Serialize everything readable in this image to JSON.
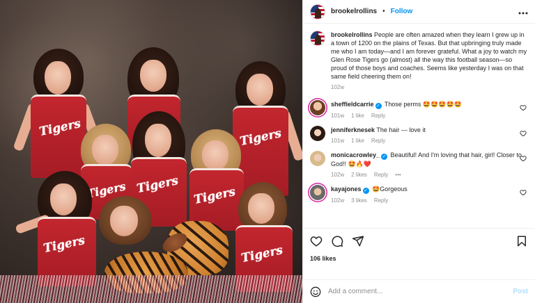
{
  "post": {
    "username": "brookelrollins",
    "separator": "•",
    "follow_label": "Follow",
    "more_label": "•••",
    "photo_team_text": "Tigers"
  },
  "caption": {
    "username": "brookelrollins",
    "text": "People are often amazed when they learn I grew up in a town of 1200 on the plains of Texas. But that upbringing truly made me who I am today—and I am forever grateful. What a joy to watch my Glen Rose Tigers go (almost) all the way this football season—so proud of those boys and coaches. Seems like yesterday I was on that same field cheering them on!",
    "time": "102w"
  },
  "comments": [
    {
      "username": "sheffieldcarrie",
      "verified": true,
      "text": "Those perms 🤩🤩🤩🤩🤩",
      "time": "101w",
      "likes": "1 like",
      "reply": "Reply",
      "more": ""
    },
    {
      "username": "jenniferknesek",
      "verified": false,
      "text": "The hair — love it",
      "time": "101w",
      "likes": "1 like",
      "reply": "Reply",
      "more": ""
    },
    {
      "username": "monicacrowley_",
      "verified": true,
      "text": "Beautiful! And I'm loving that hair, girl! Closer to God!! 🤩🔥❤️",
      "time": "102w",
      "likes": "2 likes",
      "reply": "Reply",
      "more": "•••"
    },
    {
      "username": "kayajones",
      "verified": true,
      "text": "🤩Gorgeous",
      "time": "102w",
      "likes": "3 likes",
      "reply": "Reply",
      "more": ""
    }
  ],
  "actions": {
    "likes_label": "106 likes"
  },
  "add_comment": {
    "placeholder": "Add a comment...",
    "post_label": "Post"
  },
  "icons": {
    "like": "heart-icon",
    "comment": "comment-icon",
    "share": "share-icon",
    "save": "bookmark-icon",
    "emoji": "emoji-icon"
  },
  "colors": {
    "accent": "#0095f6",
    "uniform_red": "#c3262e",
    "post_disabled": "#b2dffc"
  }
}
